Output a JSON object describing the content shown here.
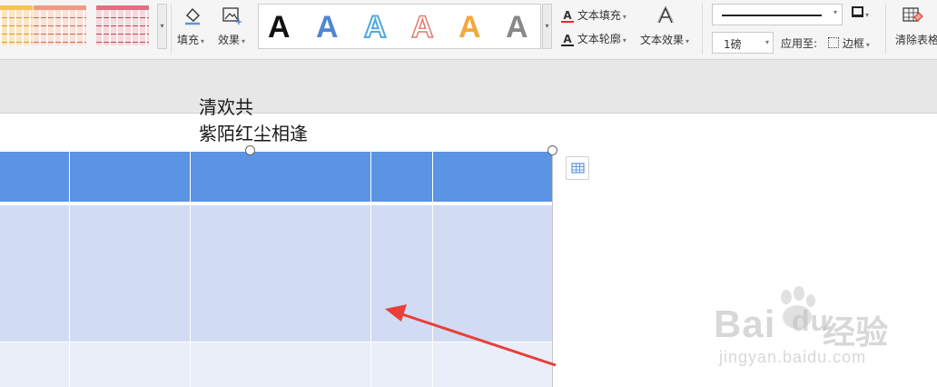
{
  "ribbon": {
    "table_styles": [
      {
        "header": "#f6c15a",
        "body": "#fbe5c2",
        "line": "#d99a2c"
      },
      {
        "header": "#ef9a80",
        "body": "#fbe1d9",
        "line": "#c96a50"
      },
      {
        "header": "#e0707f",
        "body": "#f8d8dd",
        "line": "#b84a5a"
      }
    ],
    "fill_label": "填充",
    "effects_label": "效果",
    "word_art": [
      {
        "glyph": "A",
        "style": "black"
      },
      {
        "glyph": "A",
        "style": "blue"
      },
      {
        "glyph": "A",
        "style": "blue-outline"
      },
      {
        "glyph": "A",
        "style": "red-outline"
      },
      {
        "glyph": "A",
        "style": "orange"
      },
      {
        "glyph": "A",
        "style": "gray-gradient"
      }
    ],
    "text_fill_label": "文本填充",
    "text_outline_label": "文本轮廓",
    "text_effects_label": "文本效果",
    "line_weight_value": "1磅",
    "apply_to_label": "应用至:",
    "border_label": "边框",
    "clear_table_label": "清除表格"
  },
  "document": {
    "cell_line1": "清欢共",
    "cell_line2": "紫陌红尘相逢"
  },
  "watermark": {
    "brand": "Bai",
    "paw_text": "du",
    "suffix": "经验",
    "url": "jingyan.baidu.com"
  },
  "colors": {
    "header_blue": "#5a94e2",
    "band_light": "#d1dcf4",
    "band_lighter": "#e9eef9",
    "arrow_red": "#e8403a",
    "text_fill_underline": "#d9302a"
  }
}
